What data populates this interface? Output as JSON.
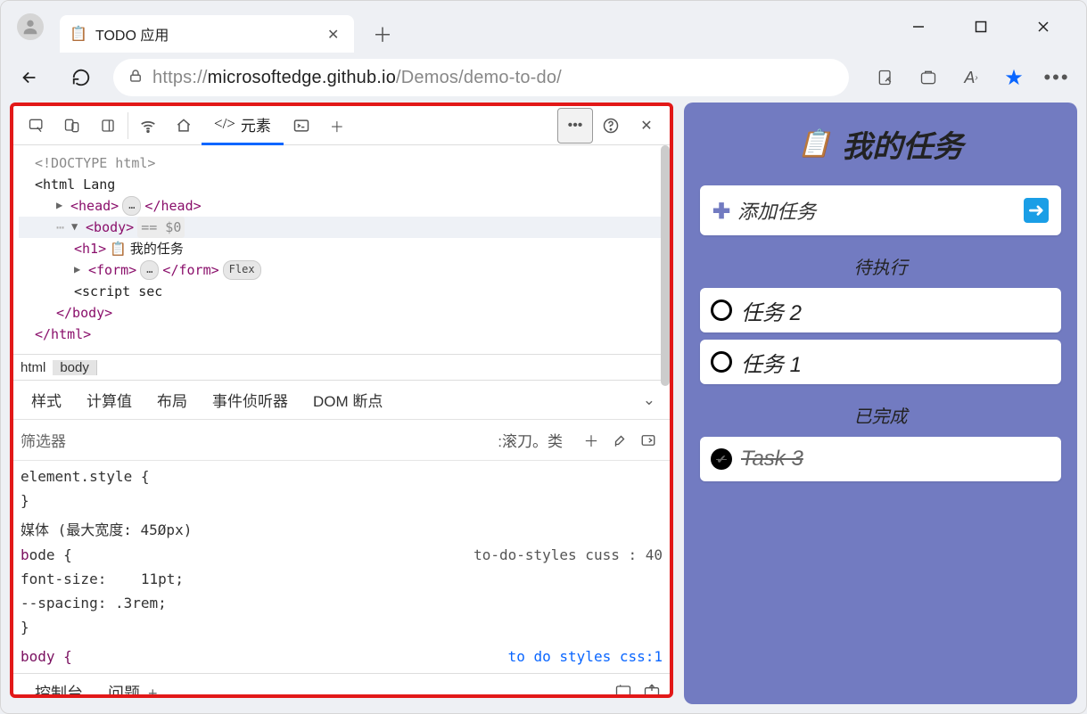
{
  "tab": {
    "title": "TODO 应用",
    "icon": "📋"
  },
  "url": {
    "lock": "🔒",
    "prefix": "https://",
    "domain": "microsoftedge.github.io",
    "path": "/Demos/demo-to-do/"
  },
  "devtools": {
    "elements_tab": "元素",
    "dom": {
      "doctype": "<!DOCTYPE html>",
      "html_open": "<html Lang",
      "head_open": "<head>",
      "head_ellipsis": "…",
      "head_close": "</head>",
      "body_open": "<body>",
      "body_sel": " == $0",
      "h1_open": "<h1>",
      "h1_text": " 我的任务",
      "form_open": "<form>",
      "form_close": "</form>",
      "flex_pill": "Flex",
      "script": "<script sec",
      "body_close": "</body>",
      "html_close": "</html>"
    },
    "breadcrumb": {
      "html": "html",
      "body": "body"
    },
    "style_tabs": {
      "styles": "样式",
      "computed": "计算值",
      "layout": "布局",
      "listeners": "事件侦听器",
      "dom_bp": "DOM 断点"
    },
    "filter": {
      "placeholder": "筛选器",
      "hov": ":滚刀。类"
    },
    "styles": {
      "elstyle": "element.style {",
      "brace": "}",
      "media": "媒体 (最大宽度: 45Øpx)",
      "bodysel": "ode {",
      "bodypfx": "b",
      "link1": "to-do-styles cuss :  40",
      "fs": "  font-size:",
      "fsv": "11pt;",
      "sp": "  --spacing:",
      "spv": ".3rem;",
      "link2": "to do styles css:1"
    },
    "drawer": {
      "console": "控制台",
      "problems": "问题",
      "plus": "+"
    }
  },
  "app": {
    "title": "我的任务",
    "add_placeholder": "添加任务",
    "pending": "待执行",
    "done": "已完成",
    "tasks_pending": [
      {
        "label": "任务 2"
      },
      {
        "label": "任务 1"
      }
    ],
    "tasks_done": [
      {
        "label": "Task 3"
      }
    ]
  }
}
